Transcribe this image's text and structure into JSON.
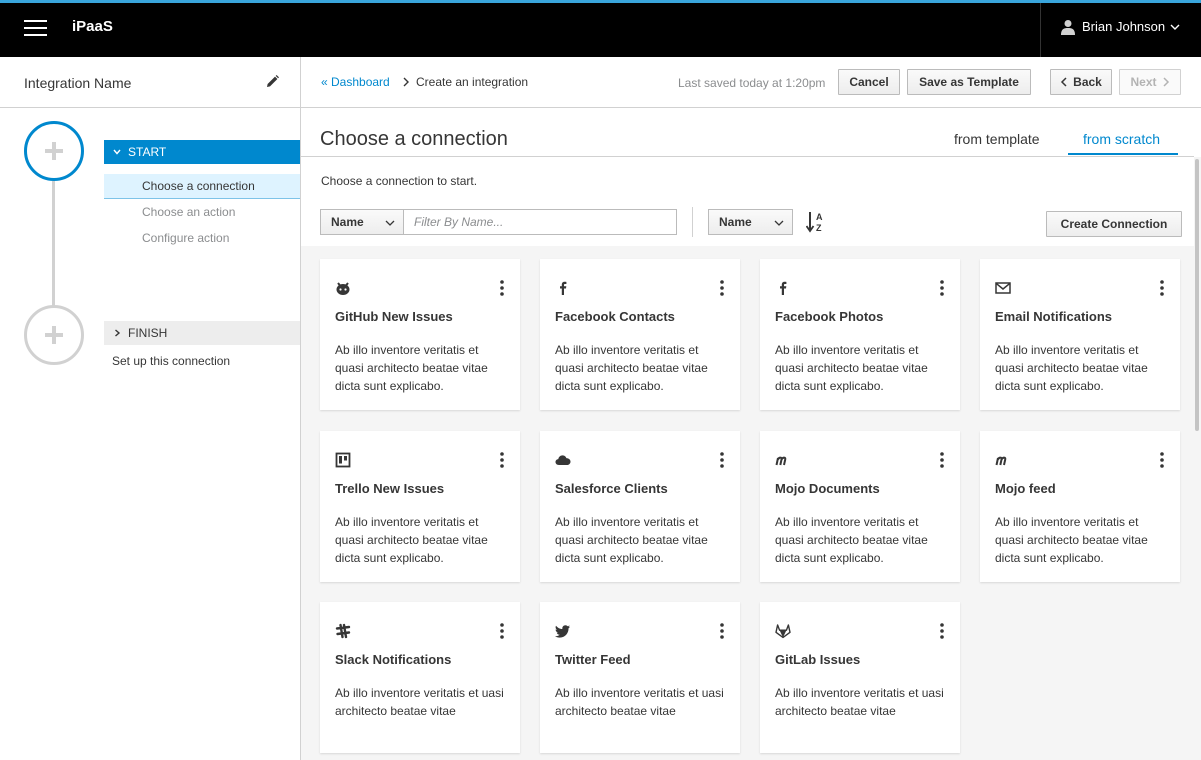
{
  "nav": {
    "brand": "iPaaS",
    "user": "Brian Johnson"
  },
  "sidebar": {
    "integration_name": "Integration Name",
    "start": {
      "label": "START",
      "substeps": [
        "Choose a connection",
        "Choose an action",
        "Configure action"
      ]
    },
    "finish": {
      "label": "FINISH",
      "description": "Set up this connection"
    }
  },
  "toolbar": {
    "breadcrumb_link": "Dashboard",
    "breadcrumb_current": "Create an integration",
    "saved": "Last saved today at 1:20pm",
    "cancel": "Cancel",
    "save_template": "Save as Template",
    "back": "Back",
    "next": "Next"
  },
  "page": {
    "title": "Choose a connection",
    "tabs": [
      "from template",
      "from scratch"
    ],
    "active_tab": "from scratch",
    "subtitle": "Choose a connection to start."
  },
  "filter": {
    "field": "Name",
    "placeholder": "Filter By Name...",
    "sort_field": "Name",
    "create_button": "Create Connection"
  },
  "cards": [
    {
      "title": "GitHub New Issues",
      "icon": "github-icon",
      "desc": "Ab illo inventore veritatis et quasi architecto beatae vitae dicta sunt explicabo."
    },
    {
      "title": "Facebook Contacts",
      "icon": "facebook-icon",
      "desc": "Ab illo inventore veritatis et quasi architecto beatae vitae dicta sunt explicabo."
    },
    {
      "title": "Facebook Photos",
      "icon": "facebook-icon",
      "desc": "Ab illo inventore veritatis et quasi architecto beatae vitae dicta sunt explicabo."
    },
    {
      "title": "Email Notifications",
      "icon": "envelope-icon",
      "desc": "Ab illo inventore veritatis et quasi architecto beatae vitae dicta sunt explicabo."
    },
    {
      "title": "Trello New Issues",
      "icon": "trello-icon",
      "desc": "Ab illo inventore veritatis et quasi architecto beatae vitae dicta sunt explicabo."
    },
    {
      "title": "Salesforce Clients",
      "icon": "cloud-icon",
      "desc": "Ab illo inventore veritatis et quasi architecto beatae vitae dicta sunt explicabo."
    },
    {
      "title": "Mojo Documents",
      "icon": "mojo-icon",
      "desc": "Ab illo inventore veritatis et quasi architecto beatae vitae dicta sunt explicabo."
    },
    {
      "title": "Mojo feed",
      "icon": "mojo-icon",
      "desc": "Ab illo inventore veritatis et quasi architecto beatae vitae dicta sunt explicabo."
    },
    {
      "title": "Slack Notifications",
      "icon": "slack-icon",
      "desc": "Ab illo inventore veritatis et uasi architecto beatae vitae"
    },
    {
      "title": "Twitter Feed",
      "icon": "twitter-icon",
      "desc": "Ab illo inventore veritatis et uasi architecto beatae vitae"
    },
    {
      "title": "GitLab Issues",
      "icon": "gitlab-icon",
      "desc": "Ab illo inventore veritatis et uasi architecto beatae vitae"
    }
  ],
  "colors": {
    "accent": "#0088ce",
    "topbar": "#000000",
    "topbar_border": "#39a5dc",
    "selected_substep": "#def3ff"
  }
}
